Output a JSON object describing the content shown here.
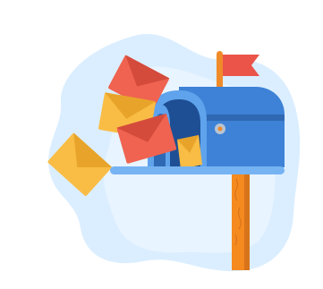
{
  "illustration": {
    "icon": "mailbox-with-flying-letters-icon",
    "colors": {
      "background_blob": "#dbeeff",
      "background_blob_light": "#e8f4ff",
      "mailbox_body": "#3d82d6",
      "mailbox_front": "#5fa3ec",
      "mailbox_dark": "#2f68b3",
      "mailbox_inner": "#1e4f94",
      "mailbox_base": "#76b3f3",
      "flag_red": "#ea5449",
      "flag_pole": "#f08b2a",
      "post_orange": "#f58a1f",
      "post_orange_dark": "#d8741a",
      "envelope_red": "#ef6350",
      "envelope_red_dark": "#d44b3c",
      "envelope_yellow": "#f9bd45",
      "envelope_yellow_dark": "#e8a42a",
      "pivot_gray": "#b8c4d3"
    }
  }
}
